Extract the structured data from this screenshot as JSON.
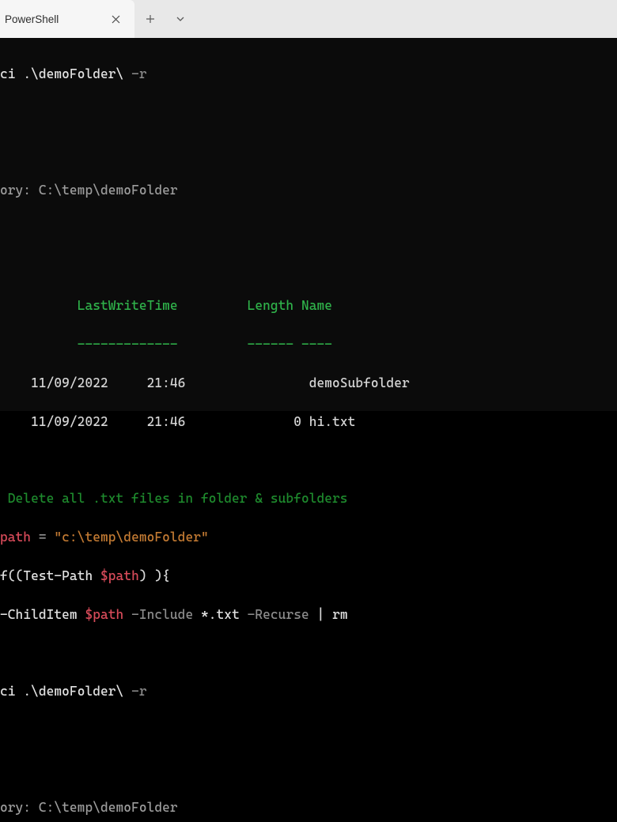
{
  "titlebar": {
    "tab_title": "PowerShell"
  },
  "cmd1": {
    "gci": "ci ",
    "path": ".\\demoFolder\\ ",
    "flag": "-r"
  },
  "dir_header": "ory: C:\\temp\\demoFolder",
  "columns": {
    "lwt": "LastWriteTime",
    "length": "Length",
    "name": "Name",
    "dash_lwt": "-------------",
    "dash_len": "------",
    "dash_name": "----"
  },
  "rows": [
    {
      "date": "11/09/2022",
      "time": "21:46",
      "length": "",
      "name": "demoSubfolder"
    },
    {
      "date": "11/09/2022",
      "time": "21:46",
      "length": "0",
      "name": "hi.txt"
    }
  ],
  "script": {
    "comment": " Delete all .txt files in folder & subfolders",
    "var_path": "path",
    "eq": " = ",
    "str_path": "\"c:\\temp\\demoFolder\"",
    "if_start1": "f",
    "if_start2": "((",
    "testpath": "Test-Path ",
    "var_path_ref": "$path",
    "if_end": ") ){",
    "gcichild": "-ChildItem ",
    "flag_include": "-Include ",
    "glob": "*.txt ",
    "flag_recurse": "-Recurse ",
    "pipe": "| ",
    "rm": "rm"
  },
  "cmd2": {
    "gci": "ci ",
    "path": ".\\demoFolder\\ ",
    "flag": "-r"
  },
  "dir_header2": "ory: C:\\temp\\demoFolder"
}
